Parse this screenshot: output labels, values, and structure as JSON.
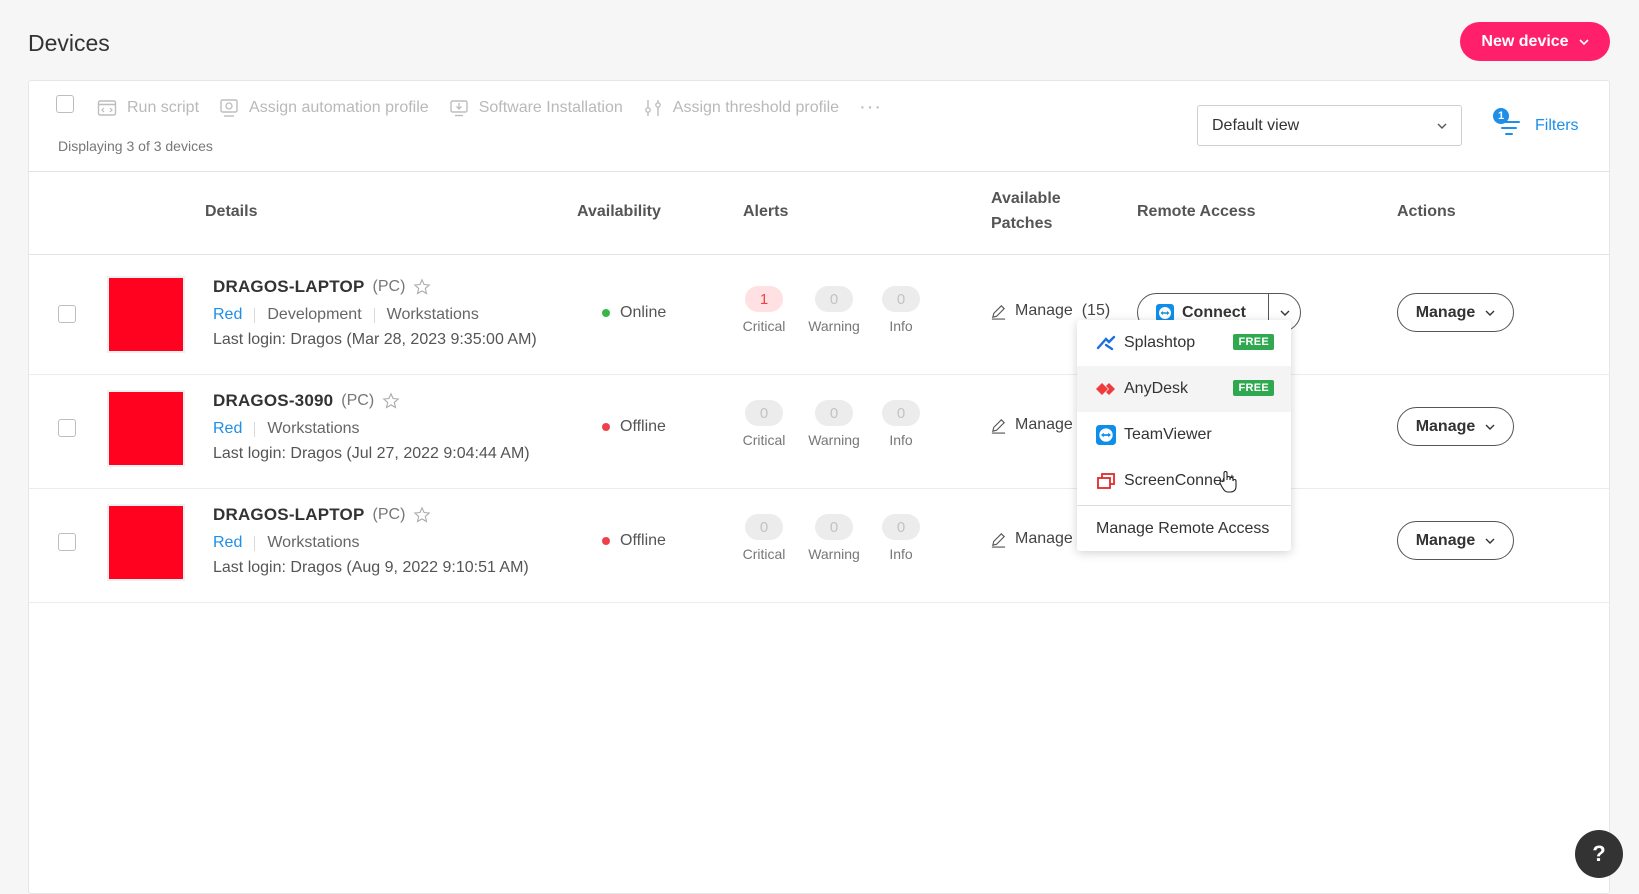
{
  "page": {
    "title": "Devices",
    "new_device_label": "New device"
  },
  "toolbar": {
    "actions": [
      {
        "label": "Run script",
        "icon": "script-icon"
      },
      {
        "label": "Assign automation profile",
        "icon": "automation-icon"
      },
      {
        "label": "Software Installation",
        "icon": "install-icon"
      },
      {
        "label": "Assign threshold profile",
        "icon": "threshold-icon"
      }
    ],
    "more_label": "···",
    "displaying": "Displaying 3 of 3 devices",
    "view_select": "Default view",
    "filters_label": "Filters",
    "filters_count": "1"
  },
  "columns": {
    "details": "Details",
    "availability": "Availability",
    "alerts": "Alerts",
    "patches_line1": "Available",
    "patches_line2": "Patches",
    "remote": "Remote Access",
    "actions": "Actions"
  },
  "devices": [
    {
      "name": "DRAGOS-LAPTOP",
      "type": "(PC)",
      "tags": [
        "Red",
        "Development",
        "Workstations"
      ],
      "last_login": "Last login: Dragos (Mar 28, 2023 9:35:00 AM)",
      "status": "Online",
      "alerts": {
        "critical": "1",
        "warning": "0",
        "info": "0"
      },
      "patches": "Manage  (15)",
      "connect_label": "Connect",
      "manage_label": "Manage"
    },
    {
      "name": "DRAGOS-3090",
      "type": "(PC)",
      "tags": [
        "Red",
        "Workstations"
      ],
      "last_login": "Last login: Dragos (Jul 27, 2022 9:04:44 AM)",
      "status": "Offline",
      "alerts": {
        "critical": "0",
        "warning": "0",
        "info": "0"
      },
      "patches": "Manage",
      "manage_label": "Manage"
    },
    {
      "name": "DRAGOS-LAPTOP",
      "type": "(PC)",
      "tags": [
        "Red",
        "Workstations"
      ],
      "last_login": "Last login: Dragos (Aug 9, 2022 9:10:51 AM)",
      "status": "Offline",
      "alerts": {
        "critical": "0",
        "warning": "0",
        "info": "0"
      },
      "patches": "Manage",
      "manage_label": "Manage"
    }
  ],
  "alert_labels": {
    "critical": "Critical",
    "warning": "Warning",
    "info": "Info"
  },
  "remote_menu": {
    "items": [
      {
        "label": "Splashtop",
        "badge": "FREE",
        "icon": "splashtop-icon"
      },
      {
        "label": "AnyDesk",
        "badge": "FREE",
        "icon": "anydesk-icon"
      },
      {
        "label": "TeamViewer",
        "icon": "teamviewer-icon"
      },
      {
        "label": "ScreenConnect",
        "icon": "screenconnect-icon"
      }
    ],
    "manage_label": "Manage Remote Access"
  },
  "help_label": "?",
  "colors": {
    "accent": "#ff1f6b",
    "link": "#1d8fe8",
    "online": "#3bb54a",
    "offline": "#f0404c",
    "thumb": "#ff0220"
  }
}
